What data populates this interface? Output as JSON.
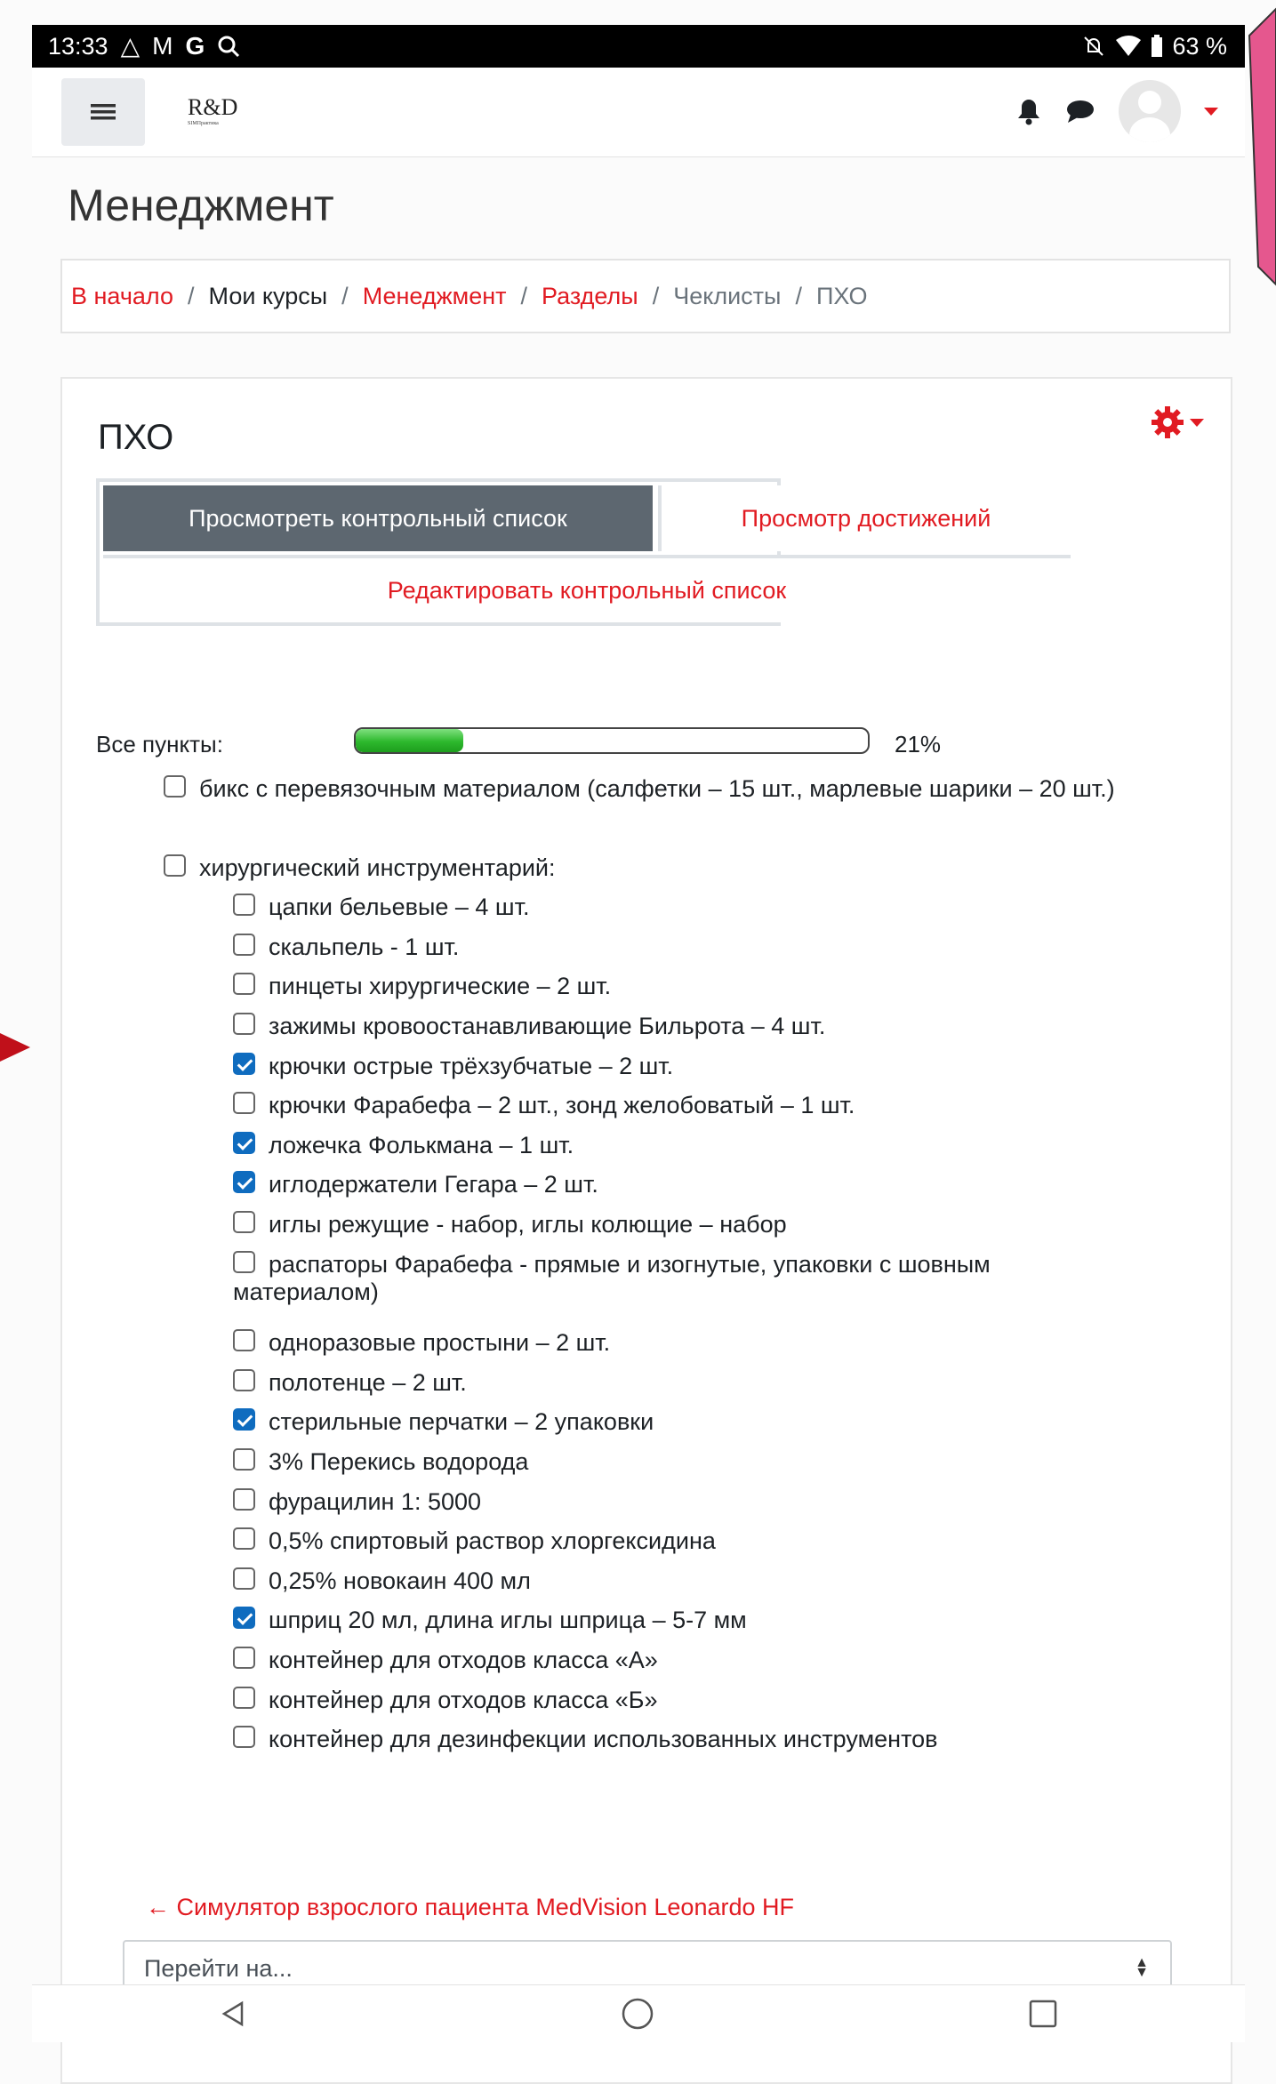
{
  "status_bar": {
    "time": "13:33",
    "left_icons": [
      "hotspot-icon",
      "gmail-icon",
      "google-icon",
      "search-icon"
    ],
    "battery": "63 %"
  },
  "navbar": {
    "logo_text": "R&D",
    "logo_subtext": "SIMПрактика"
  },
  "page": {
    "title": "Менеджмент"
  },
  "breadcrumb": [
    {
      "label": "В начало",
      "style": "link"
    },
    {
      "label": "Мои курсы",
      "style": "plain"
    },
    {
      "label": "Менеджмент",
      "style": "link"
    },
    {
      "label": "Разделы",
      "style": "link"
    },
    {
      "label": "Чеклисты",
      "style": "muted"
    },
    {
      "label": "ПХО",
      "style": "muted"
    }
  ],
  "breadcrumb_separator": "/",
  "card": {
    "title": "ПХО",
    "tabs": {
      "view": "Просмотреть контрольный список",
      "achievements": "Просмотр достижений",
      "edit": "Редактировать контрольный список"
    },
    "progress": {
      "label": "Все пункты:",
      "percent_text": "21%",
      "value": 0.21
    }
  },
  "checklist": [
    {
      "text": "бикс с перевязочным материалом (салфетки – 15 шт., марлевые шарики – 20 шт.)",
      "checked": false,
      "level": 0
    },
    {
      "text": "хирургический инструментарий:",
      "checked": false,
      "level": 0
    },
    {
      "text": "цапки бельевые – 4 шт.",
      "checked": false,
      "level": 1
    },
    {
      "text": "скальпель - 1 шт.",
      "checked": false,
      "level": 1
    },
    {
      "text": "пинцеты хирургические – 2 шт.",
      "checked": false,
      "level": 1
    },
    {
      "text": "зажимы кровоостанавливающие Бильрота – 4 шт.",
      "checked": false,
      "level": 1
    },
    {
      "text": "крючки острые трёхзубчатые – 2 шт.",
      "checked": true,
      "level": 1
    },
    {
      "text": "крючки Фарабефа – 2 шт., зонд желобоватый – 1 шт.",
      "checked": false,
      "level": 1
    },
    {
      "text": "ложечка Фолькмана – 1 шт.",
      "checked": true,
      "level": 1
    },
    {
      "text": "иглодержатели Гегара – 2 шт.",
      "checked": true,
      "level": 1
    },
    {
      "text": "иглы режущие - набор, иглы колющие – набор",
      "checked": false,
      "level": 1
    },
    {
      "text": "распаторы Фарабефа - прямые и изогнутые, упаковки с шовным материалом)",
      "checked": false,
      "level": 1
    },
    {
      "text": "одноразовые простыни – 2 шт.",
      "checked": false,
      "level": 1
    },
    {
      "text": "полотенце – 2 шт.",
      "checked": false,
      "level": 1
    },
    {
      "text": "стерильные перчатки – 2 упаковки",
      "checked": true,
      "level": 1
    },
    {
      "text": "3% Перекись водорода",
      "checked": false,
      "level": 1
    },
    {
      "text": "фурацилин 1: 5000",
      "checked": false,
      "level": 1
    },
    {
      "text": "0,5% спиртовый раствор хлоргексидина",
      "checked": false,
      "level": 1
    },
    {
      "text": "0,25% новокаин 400 мл",
      "checked": false,
      "level": 1
    },
    {
      "text": "шприц 20 мл, длина иглы шприца – 5-7 мм",
      "checked": true,
      "level": 1
    },
    {
      "text": "контейнер для отходов класса «А»",
      "checked": false,
      "level": 1
    },
    {
      "text": "контейнер для отходов класса «Б»",
      "checked": false,
      "level": 1
    },
    {
      "text": "контейнер для дезинфекции использованных инструментов",
      "checked": false,
      "level": 1
    }
  ],
  "footer": {
    "prev_link": "← Симулятор взрослого пациента MedVision Leonardo HF",
    "jump_select_value": "Перейти на..."
  },
  "colors": {
    "accent": "#e11b22",
    "active_tab": "#5d6770",
    "checkbox_checked": "#0f6cbf"
  }
}
